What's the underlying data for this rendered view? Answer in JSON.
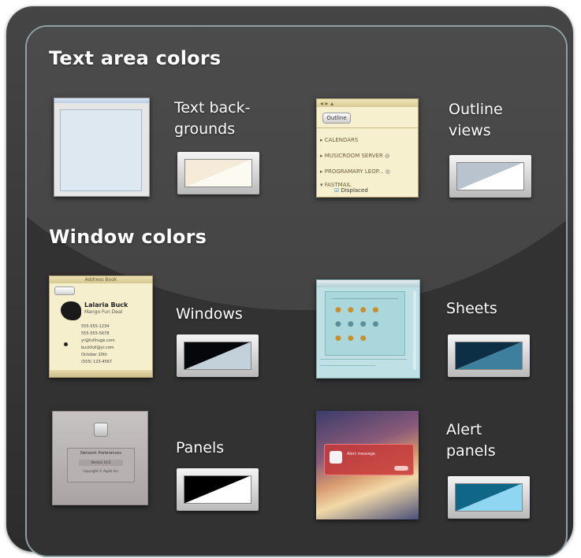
{
  "sections": {
    "text_area": "Text area colors",
    "window": "Window colors"
  },
  "items": {
    "text_backgrounds": {
      "line1": "Text back-",
      "line2": "grounds",
      "colors": [
        "#f5ebd8",
        "#fdfaf2"
      ]
    },
    "outline_views": {
      "line1": "Outline",
      "line2": "views",
      "colors": [
        "#b9c3cd",
        "#ffffff"
      ]
    },
    "windows": {
      "label": "Windows",
      "colors": [
        "#06070b",
        "#c3d1db"
      ]
    },
    "sheets": {
      "label": "Sheets",
      "colors": [
        "#0d2f46",
        "#3f7f9e"
      ]
    },
    "panels": {
      "label": "Panels",
      "colors": [
        "#000000",
        "#ffffff"
      ]
    },
    "alert_panels": {
      "line1": "Alert",
      "line2": "panels",
      "colors": [
        "#106686",
        "#8fd6f2"
      ]
    }
  },
  "outline_thumb": {
    "button": "Outline",
    "rows": [
      "CALENDARS",
      "MUSICROOM SERVER",
      "PROGRAMARY LEOP...",
      "FASTMAIL"
    ],
    "checkbox": "Displaced"
  },
  "window_thumb": {
    "title": "Address Book",
    "name": "Lalaria Buck",
    "company": "Mango Fun Deal",
    "lines": [
      "555-555-1234",
      "555-555-5678",
      "yr@fullhuge.com",
      "buckfull@yr.com",
      "October 20th",
      "(555) 123-4567"
    ]
  },
  "panel_thumb": {
    "title": "Network Preferences",
    "line1": "Version 10.5",
    "line2": "Copyright © Apple Inc."
  },
  "alert_thumb": {
    "line": "Alert message"
  }
}
